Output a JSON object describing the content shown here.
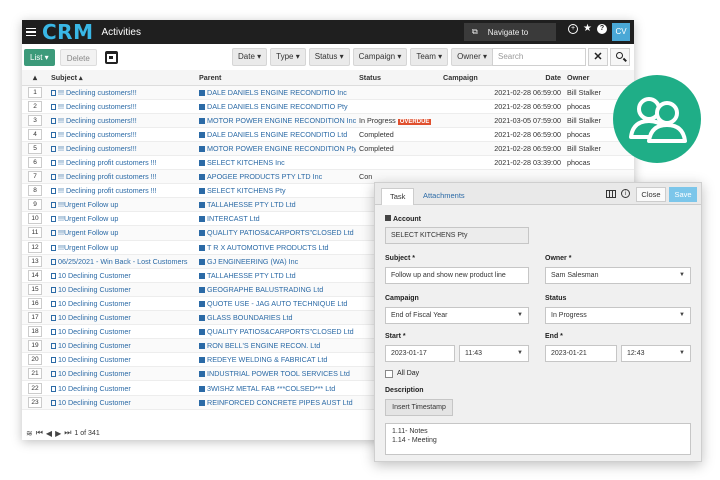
{
  "header": {
    "logo": "CRM",
    "title": "Activities",
    "navigate": "Navigate to",
    "avatar": "CV",
    "icons": [
      "plus-icon",
      "star-icon",
      "help-icon"
    ]
  },
  "toolbar": {
    "list_label": "List ▾",
    "delete_label": "Delete",
    "filters": [
      "Date ▾",
      "Type ▾",
      "Status ▾",
      "Campaign ▾",
      "Team ▾",
      "Owner ▾"
    ],
    "search_placeholder": "Search"
  },
  "table": {
    "columns": [
      "",
      "Subject ▴",
      "Parent",
      "Status",
      "Campaign",
      "Date",
      "Owner"
    ],
    "rows": [
      {
        "n": "1",
        "subject": "!!! Declining customers!!!",
        "parent": "DALE DANIELS ENGINE RECONDITIO Inc",
        "status": "",
        "overdue": "",
        "campaign": "",
        "date": "2021-02-28 06:59:00",
        "owner": "Bill Stalker"
      },
      {
        "n": "2",
        "subject": "!!! Declining customers!!!",
        "parent": "DALE DANIELS ENGINE RECONDITIO Pty",
        "status": "",
        "overdue": "",
        "campaign": "",
        "date": "2021-02-28 06:59:00",
        "owner": "phocas"
      },
      {
        "n": "3",
        "subject": "!!! Declining customers!!!",
        "parent": "MOTOR POWER ENGINE RECONDITION Inc",
        "status": "In Progress",
        "overdue": "OVERDUE",
        "campaign": "",
        "date": "2021-03-05 07:59:00",
        "owner": "Bill Stalker"
      },
      {
        "n": "4",
        "subject": "!!! Declining customers!!!",
        "parent": "DALE DANIELS ENGINE RECONDITIO Ltd",
        "status": "Completed",
        "overdue": "",
        "campaign": "",
        "date": "2021-02-28 06:59:00",
        "owner": "phocas"
      },
      {
        "n": "5",
        "subject": "!!! Declining customers!!!",
        "parent": "MOTOR POWER ENGINE RECONDITION Pty",
        "status": "Completed",
        "overdue": "",
        "campaign": "",
        "date": "2021-02-28 06:59:00",
        "owner": "Bill Stalker"
      },
      {
        "n": "6",
        "subject": "!!! Declining profit customers !!!",
        "parent": "SELECT KITCHENS Inc",
        "status": "",
        "overdue": "",
        "campaign": "",
        "date": "2021-02-28 03:39:00",
        "owner": "phocas"
      },
      {
        "n": "7",
        "subject": "!!! Declining profit customers !!!",
        "parent": "APOGEE PRODUCTS PTY LTD Inc",
        "status": "Con",
        "overdue": "",
        "campaign": "",
        "date": "",
        "owner": ""
      },
      {
        "n": "8",
        "subject": "!!! Declining profit customers !!!",
        "parent": "SELECT KITCHENS Pty",
        "status": "",
        "overdue": "",
        "campaign": "",
        "date": "",
        "owner": ""
      },
      {
        "n": "9",
        "subject": "!!!Urgent Follow up",
        "parent": "TALLAHESSE PTY LTD Ltd",
        "status": "",
        "overdue": "",
        "campaign": "",
        "date": "",
        "owner": ""
      },
      {
        "n": "10",
        "subject": "!!!Urgent Follow up",
        "parent": "INTERCAST Ltd",
        "status": "",
        "overdue": "",
        "campaign": "",
        "date": "",
        "owner": ""
      },
      {
        "n": "11",
        "subject": "!!!Urgent Follow up",
        "parent": "QUALITY PATIOS&CARPORTS\"CLOSED Ltd",
        "status": "",
        "overdue": "",
        "campaign": "",
        "date": "",
        "owner": ""
      },
      {
        "n": "12",
        "subject": "!!!Urgent Follow up",
        "parent": "T R X AUTOMOTIVE PRODUCTS Ltd",
        "status": "",
        "overdue": "",
        "campaign": "",
        "date": "",
        "owner": ""
      },
      {
        "n": "13",
        "subject": "06/25/2021 - Win Back - Lost Customers",
        "parent": "GJ ENGINEERING (WA) Inc",
        "status": "",
        "overdue": "",
        "campaign": "",
        "date": "",
        "owner": ""
      },
      {
        "n": "14",
        "subject": "10 Declining Customer",
        "parent": "TALLAHESSE PTY LTD Ltd",
        "status": "",
        "overdue": "",
        "campaign": "",
        "date": "",
        "owner": ""
      },
      {
        "n": "15",
        "subject": "10 Declining Customer",
        "parent": "GEOGRAPHE BALUSTRADING Ltd",
        "status": "",
        "overdue": "",
        "campaign": "",
        "date": "",
        "owner": ""
      },
      {
        "n": "16",
        "subject": "10 Declining Customer",
        "parent": "QUOTE USE - JAG AUTO TECHNIQUE Ltd",
        "status": "",
        "overdue": "",
        "campaign": "",
        "date": "",
        "owner": ""
      },
      {
        "n": "17",
        "subject": "10 Declining Customer",
        "parent": "GLASS BOUNDARIES Ltd",
        "status": "",
        "overdue": "",
        "campaign": "",
        "date": "",
        "owner": ""
      },
      {
        "n": "18",
        "subject": "10 Declining Customer",
        "parent": "QUALITY PATIOS&CARPORTS\"CLOSED Ltd",
        "status": "",
        "overdue": "",
        "campaign": "",
        "date": "",
        "owner": ""
      },
      {
        "n": "19",
        "subject": "10 Declining Customer",
        "parent": "RON BELL'S ENGINE RECON. Ltd",
        "status": "",
        "overdue": "",
        "campaign": "",
        "date": "",
        "owner": ""
      },
      {
        "n": "20",
        "subject": "10 Declining Customer",
        "parent": "REDEYE WELDING & FABRICAT Ltd",
        "status": "",
        "overdue": "",
        "campaign": "",
        "date": "",
        "owner": ""
      },
      {
        "n": "21",
        "subject": "10 Declining Customer",
        "parent": "INDUSTRIAL POWER TOOL SERVICES Ltd",
        "status": "",
        "overdue": "",
        "campaign": "",
        "date": "",
        "owner": ""
      },
      {
        "n": "22",
        "subject": "10 Declining Customer",
        "parent": "3WISHZ METAL FAB ***COLSED*** Ltd",
        "status": "",
        "overdue": "",
        "campaign": "",
        "date": "",
        "owner": ""
      },
      {
        "n": "23",
        "subject": "10 Declining Customer",
        "parent": "REINFORCED CONCRETE PIPES AUST Ltd",
        "status": "",
        "overdue": "",
        "campaign": "",
        "date": "",
        "owner": ""
      }
    ]
  },
  "pager": {
    "text": "1 of 341"
  },
  "panel": {
    "tab_task": "Task",
    "tab_attachments": "Attachments",
    "close_label": "Close",
    "save_label": "Save",
    "account_label": "Account",
    "account_value": "SELECT KITCHENS Pty",
    "subject_label": "Subject *",
    "subject_value": "Follow up and show new product line",
    "owner_label": "Owner *",
    "owner_value": "Sam Salesman",
    "campaign_label": "Campaign",
    "campaign_value": "End of Fiscal Year",
    "status_label": "Status",
    "status_value": "In Progress",
    "start_label": "Start *",
    "start_date": "2023-01-17",
    "start_time": "11:43",
    "end_label": "End *",
    "end_date": "2023-01-21",
    "end_time": "12:43",
    "allday_label": "All Day",
    "description_label": "Description",
    "timestamp_label": "Insert Timestamp",
    "description_lines": [
      "1.11- Notes",
      "1.14 - Meeting"
    ]
  },
  "colors": {
    "accent": "#3c9a7a",
    "bubble": "#1fae87",
    "logo": "#39b7e6",
    "overdue": "#e0502e"
  }
}
